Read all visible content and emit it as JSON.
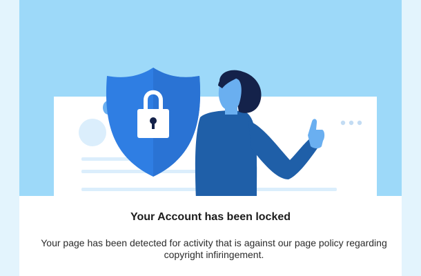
{
  "colors": {
    "background": "#9dd9f9",
    "shield": "#2f7ee3",
    "character": "#1f5fa8",
    "skin": "#6aaff0",
    "card": "#ffffff"
  },
  "illustration": {
    "shield_icon": "shield-icon",
    "lock_icon": "padlock-icon",
    "gesture": "thumbs-up"
  },
  "dialog": {
    "title": "Your Account has been locked",
    "message": "Your page has been detected for activity that is against our page policy regarding copyright infiringement."
  }
}
